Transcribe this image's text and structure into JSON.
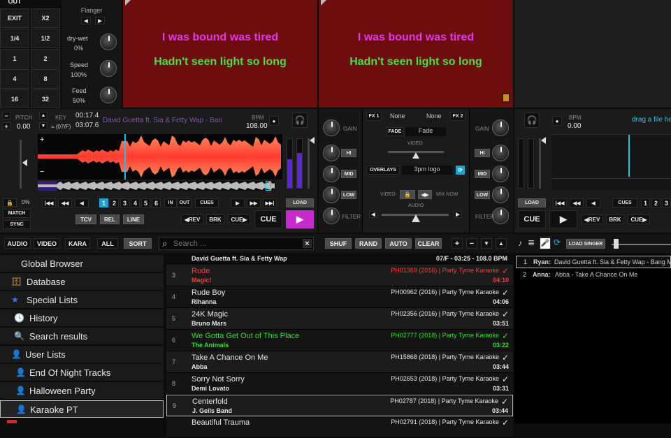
{
  "left_grid": {
    "out": "OUT",
    "exit": "EXIT",
    "x2": "X2",
    "q": "1/4",
    "h": "1/2",
    "n1": "1",
    "n2": "2",
    "n4": "4",
    "n8": "8",
    "n16": "16",
    "n32": "32"
  },
  "effects": {
    "flanger": "Flanger",
    "drywet_label": "dry-wet",
    "drywet_value": "0%",
    "speed_label": "Speed",
    "speed_value": "100%",
    "feed_label": "Feed",
    "feed_value": "50%"
  },
  "karaoke": {
    "line1": "I was bound was tired",
    "line2": "Hadn't seen light so long"
  },
  "deck1": {
    "pitch_label": "PITCH",
    "pitch_value": "0.00",
    "key_label": "KEY",
    "key_value": "= (07/F)",
    "elapsed": "00:17.4",
    "remaining": "03:07.6",
    "title": "David Guetta ft. Sia & Fetty Wap - Ban",
    "bpm_label": "BPM",
    "bpm_value": "108.00",
    "pct": "0%",
    "match": "MATCH",
    "sync": "SYNC",
    "cue_nums": [
      "1",
      "2",
      "3",
      "4",
      "5",
      "6"
    ],
    "in": "IN",
    "out": "OUT",
    "cues": "CUES",
    "load": "LOAD",
    "tcv": "TCV",
    "rel": "REL",
    "line": "LINE",
    "rev": "REV",
    "brk": "BRK",
    "cue_small": "CUE",
    "cue": "CUE"
  },
  "mixer": {
    "fx1": "FX 1",
    "fx1_value": "None",
    "fx2": "FX 2",
    "fx2_value": "None",
    "fade": "FADE",
    "fade_value": "Fade",
    "video": "VIDEO",
    "overlays": "OVERLAYS",
    "overlays_value": "3pm logo",
    "video_left": "VIDEO",
    "mix_now": "MIX NOW",
    "audio": "AUDIO",
    "gain": "GAIN",
    "hi": "HI",
    "mid": "MID",
    "low": "LOW",
    "filter": "FILTER"
  },
  "deck2": {
    "bpm_label": "BPM",
    "bpm_value": "0.00",
    "drag_text": "drag a file he",
    "load": "LOAD",
    "cues": "CUES",
    "cue_nums": [
      "1",
      "2",
      "3"
    ],
    "cue": "CUE",
    "rev": "REV",
    "brk": "BRK",
    "cue_small": "CUE"
  },
  "browser_tabs": {
    "audio": "AUDIO",
    "video": "VIDEO",
    "kara": "KARA",
    "all": "ALL",
    "sort": "SORT"
  },
  "search": {
    "placeholder": "Search ...",
    "clear": "×"
  },
  "list_tools": {
    "shuf": "SHUF",
    "rand": "RAND",
    "auto": "AUTO",
    "clear": "CLEAR",
    "plus": "+",
    "minus": "−",
    "down": "▼",
    "up": "▲"
  },
  "load_singer": "LOAD SINGER",
  "tree": [
    {
      "label": "Global Browser"
    },
    {
      "label": "Database"
    },
    {
      "label": "Special Lists"
    },
    {
      "label": "History"
    },
    {
      "label": "Search results"
    },
    {
      "label": "User Lists"
    },
    {
      "label": "End Of Night Tracks"
    },
    {
      "label": "Halloween Party"
    },
    {
      "label": "Karaoke PT"
    }
  ],
  "tracks_header": {
    "artist": "David Guetta ft. Sia & Fetty Wap",
    "info": "07/F - 03:25 - 108.0 BPM"
  },
  "tracks": [
    {
      "num": "3",
      "title": "Rude",
      "artist": "Magic!",
      "meta": "PH01369 (2016) | Party Tyme Karaoke",
      "dur": "04:10",
      "color": "#ff3b3b"
    },
    {
      "num": "4",
      "title": "Rude Boy",
      "artist": "Rihanna",
      "meta": "PH00962 (2016) | Party Tyme Karaoke",
      "dur": "04:06",
      "color": "#e8e8e8"
    },
    {
      "num": "5",
      "title": "24K Magic",
      "artist": "Bruno Mars",
      "meta": "PH02356 (2016) | Party Tyme Karaoke",
      "dur": "03:51",
      "color": "#e8e8e8"
    },
    {
      "num": "6",
      "title": "We Gotta Get Out of This Place",
      "artist": "The Animals",
      "meta": "PH02777 (2018) | Party Tyme Karaoke",
      "dur": "03:22",
      "color": "#3ddc3d"
    },
    {
      "num": "7",
      "title": "Take A Chance On Me",
      "artist": "Abba",
      "meta": "PH15868 (2018) | Party Tyme Karaoke",
      "dur": "03:44",
      "color": "#e8e8e8"
    },
    {
      "num": "8",
      "title": "Sorry Not Sorry",
      "artist": "Demi Lovato",
      "meta": "PH02653 (2018) | Party Tyme Karaoke",
      "dur": "03:31",
      "color": "#e8e8e8"
    },
    {
      "num": "9",
      "title": "Centerfold",
      "artist": "J. Geils Band",
      "meta": "PH02787 (2018) | Party Tyme Karaoke",
      "dur": "03:44",
      "color": "#e8e8e8"
    },
    {
      "num": "",
      "title": "Beautiful Trauma",
      "artist": "",
      "meta": "PH02791 (2018) | Party Tyme Karaoke",
      "dur": "",
      "color": "#e8e8e8"
    }
  ],
  "singers": [
    {
      "num": "1",
      "name": "Ryan:",
      "song": "David Guetta ft. Sia & Fetty Wap - Bang My"
    },
    {
      "num": "2",
      "name": "Anna:",
      "song": "Abba - Take A Chance On Me"
    }
  ]
}
